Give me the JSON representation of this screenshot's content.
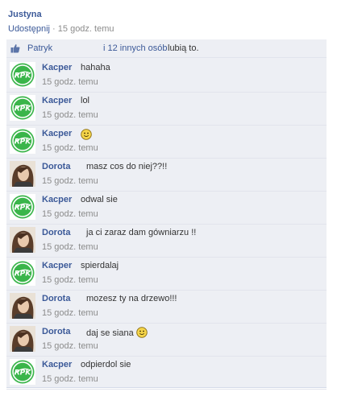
{
  "post": {
    "author": "Justyna",
    "share_label": "Udostępnij",
    "separator": "·",
    "time": "15 godz. temu"
  },
  "likes": {
    "first_name": "Patryk",
    "others": "i 12 innych osób",
    "suffix": "lubią to."
  },
  "comments": [
    {
      "author": "Kacper",
      "text": "hahaha",
      "time": "15 godz. temu",
      "avatar": "rpk-logo"
    },
    {
      "author": "Kacper",
      "text": "lol",
      "time": "15 godz. temu",
      "avatar": "rpk-logo"
    },
    {
      "author": "Kacper",
      "text": "",
      "emoticon": "smiley",
      "time": "15 godz. temu",
      "avatar": "rpk-logo"
    },
    {
      "author": "Dorota",
      "text": "masz cos do niej??!!",
      "time": "15 godz. temu",
      "avatar": "profile-photo"
    },
    {
      "author": "Kacper",
      "text": "odwal sie",
      "time": "15 godz. temu",
      "avatar": "rpk-logo"
    },
    {
      "author": "Dorota",
      "text": "ja ci zaraz dam gówniarzu !!",
      "time": "15 godz. temu",
      "avatar": "profile-photo"
    },
    {
      "author": "Kacper",
      "text": "spierdalaj",
      "time": "15 godz. temu",
      "avatar": "rpk-logo"
    },
    {
      "author": "Dorota",
      "text": "mozesz ty na drzewo!!!",
      "time": "15 godz. temu",
      "avatar": "profile-photo"
    },
    {
      "author": "Dorota",
      "text": "daj se siana",
      "emoticon": "smiley",
      "time": "15 godz. temu",
      "avatar": "profile-photo"
    },
    {
      "author": "Kacper",
      "text": "odpierdol sie",
      "time": "15 godz. temu",
      "avatar": "rpk-logo"
    }
  ],
  "avatar_logo_text": "RPK",
  "colors": {
    "link": "#3b5998",
    "panel": "#edeff4",
    "timestamp": "#8c8c8c",
    "logo_green": "#3ab54a"
  }
}
